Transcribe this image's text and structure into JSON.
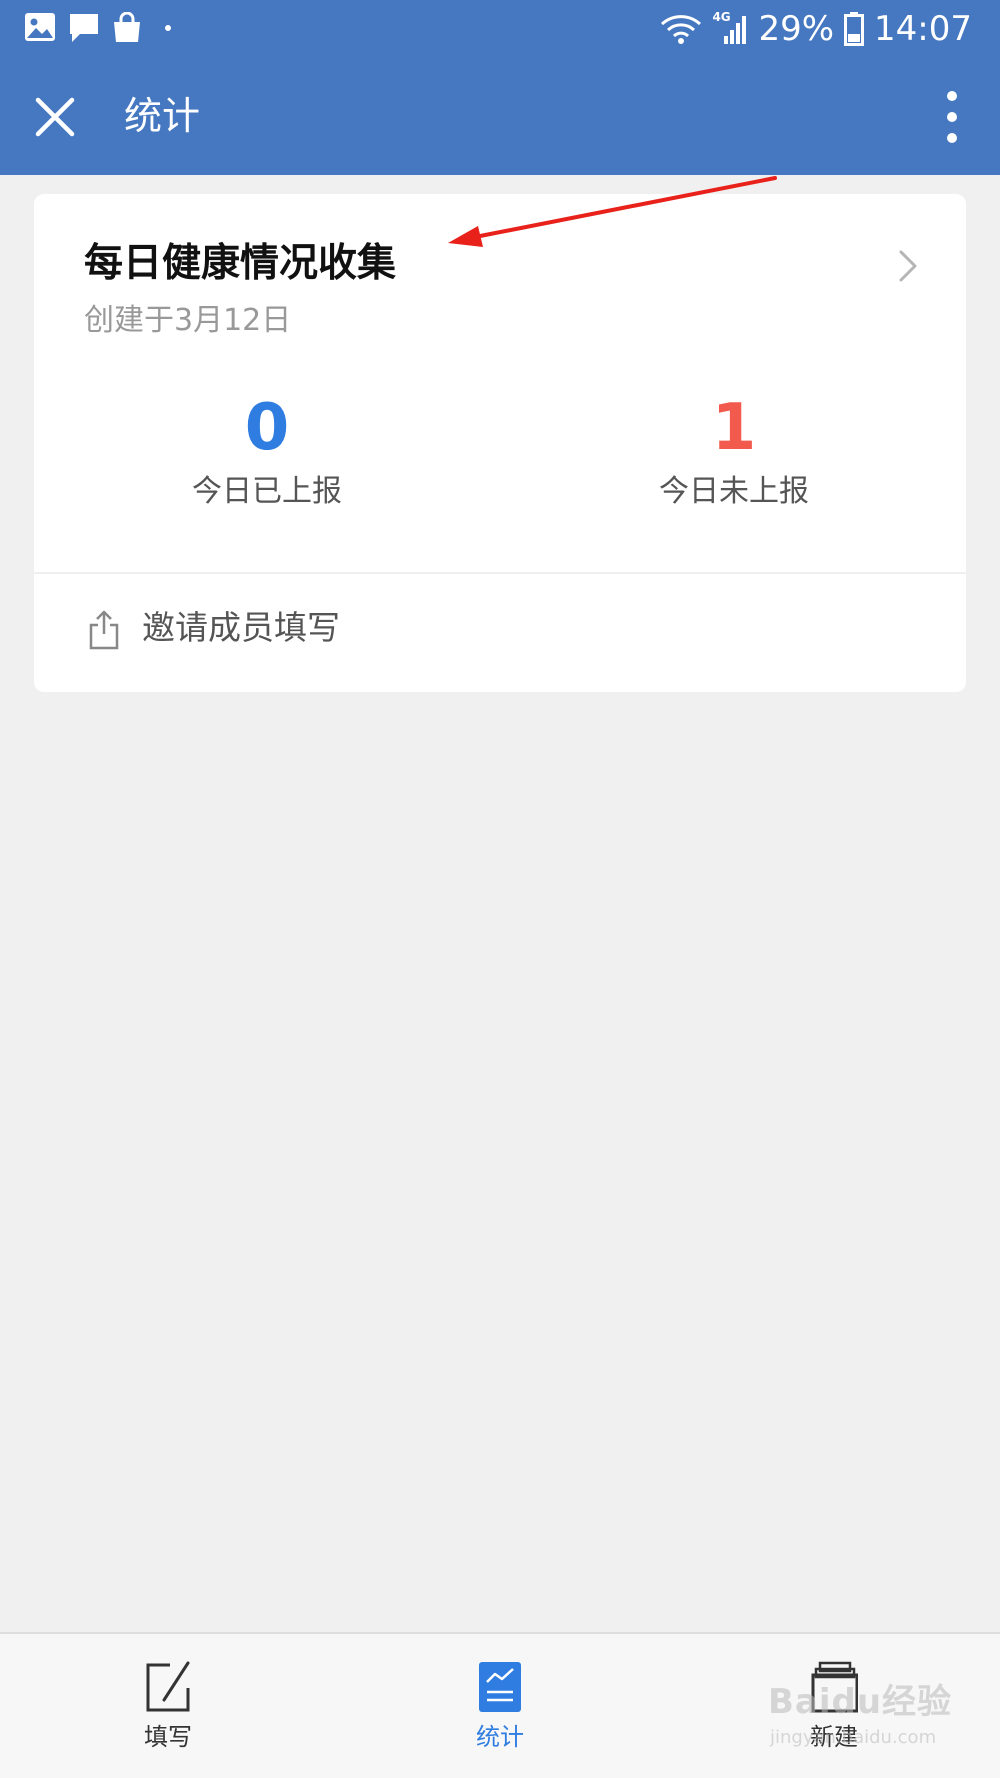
{
  "status_bar": {
    "battery": "29%",
    "time": "14:07",
    "network": "4G"
  },
  "app_bar": {
    "title": "统计"
  },
  "card": {
    "title": "每日健康情况收集",
    "created": "创建于3月12日",
    "stats": [
      {
        "value": "0",
        "label": "今日已上报",
        "color": "#2f7de1"
      },
      {
        "value": "1",
        "label": "今日未上报",
        "color": "#f25a4e"
      }
    ],
    "invite_label": "邀请成员填写"
  },
  "bottom_nav": {
    "items": [
      {
        "label": "填写",
        "active": false
      },
      {
        "label": "统计",
        "active": true
      },
      {
        "label": "新建",
        "active": false
      }
    ],
    "active_color": "#2f7de1",
    "inactive_color": "#333333"
  },
  "watermark": {
    "brand": "Baidu经验",
    "url": "jingyan.baidu.com"
  },
  "colors": {
    "header": "#4578c0",
    "annotation_arrow": "#e8221b"
  }
}
